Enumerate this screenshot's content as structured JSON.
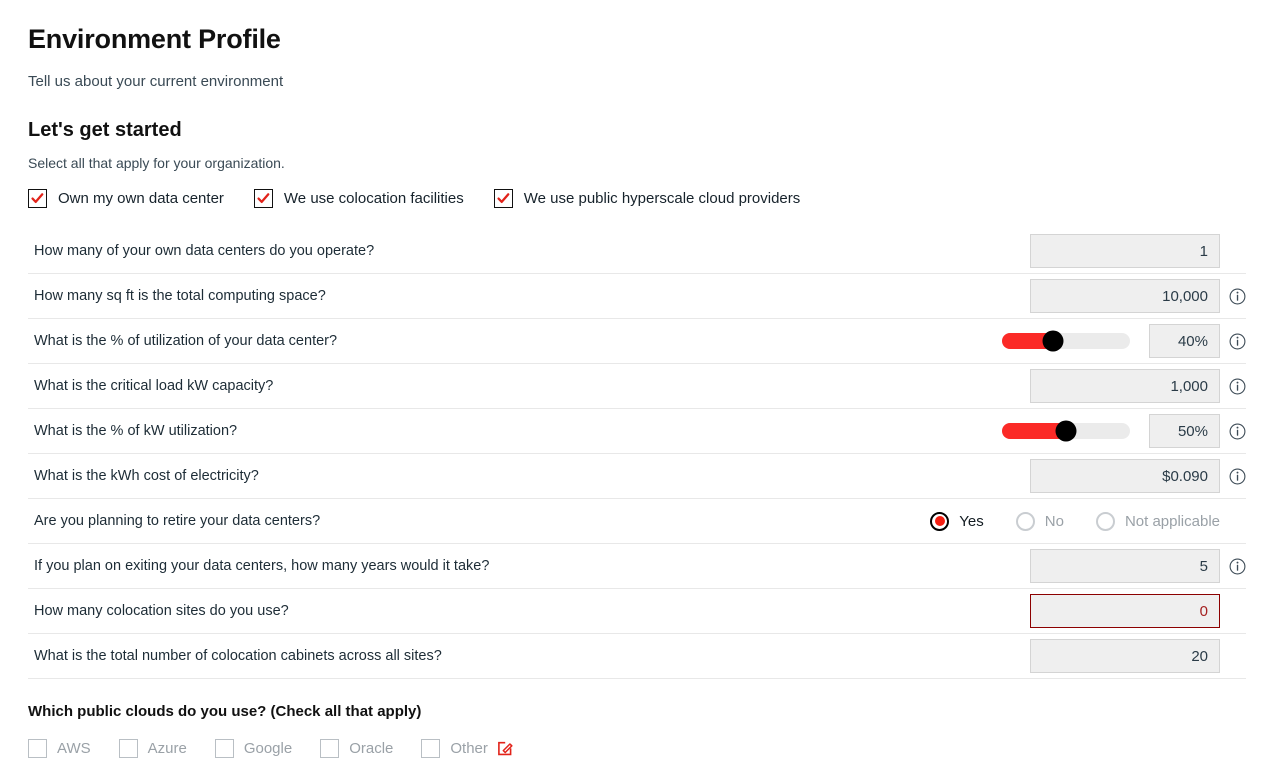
{
  "header": {
    "title": "Environment Profile",
    "subtitle": "Tell us about your current environment",
    "section_title": "Let's get started",
    "section_sub": "Select all that apply for your organization."
  },
  "colors": {
    "accent_red": "#fb2a27",
    "check_red": "#e2231a",
    "error_border": "#8c0000",
    "field_bg": "#efefef"
  },
  "top_checkboxes": [
    {
      "label": "Own my own data center",
      "checked": true,
      "icon": "checkmark-icon"
    },
    {
      "label": "We use colocation facilities",
      "checked": true,
      "icon": "checkmark-icon"
    },
    {
      "label": "We use public hyperscale cloud providers",
      "checked": true,
      "icon": "checkmark-icon"
    }
  ],
  "questions": [
    {
      "label": "How many of your own data centers do you operate?",
      "type": "number",
      "value": "1",
      "info": false
    },
    {
      "label": "How many sq ft is the total computing space?",
      "type": "number",
      "value": "10,000",
      "info": true
    },
    {
      "label": "What is the % of utilization of your data center?",
      "type": "slider",
      "value": "40%",
      "slider_percent": 40,
      "info": true
    },
    {
      "label": "What is the critical load kW capacity?",
      "type": "number",
      "value": "1,000",
      "info": true
    },
    {
      "label": "What is the % of kW utilization?",
      "type": "slider",
      "value": "50%",
      "slider_percent": 50,
      "info": true
    },
    {
      "label": "What is the kWh cost of electricity?",
      "type": "number",
      "value": "$0.090",
      "info": true
    },
    {
      "label": "Are you planning to retire your data centers?",
      "type": "radio",
      "options": [
        {
          "label": "Yes",
          "selected": true
        },
        {
          "label": "No",
          "selected": false
        },
        {
          "label": "Not applicable",
          "selected": false
        }
      ],
      "info": false
    },
    {
      "label": "If you plan on exiting your data centers, how many years would it take?",
      "type": "number",
      "value": "5",
      "info": true
    },
    {
      "label": "How many colocation sites do you use?",
      "type": "number",
      "value": "0",
      "error": true,
      "info": false
    },
    {
      "label": "What is the total number of colocation cabinets across all sites?",
      "type": "number",
      "value": "20",
      "info": false
    }
  ],
  "cloud_section": {
    "title": "Which public clouds do you use? (Check all that apply)",
    "options": [
      {
        "label": "AWS",
        "checked": false
      },
      {
        "label": "Azure",
        "checked": false
      },
      {
        "label": "Google",
        "checked": false
      },
      {
        "label": "Oracle",
        "checked": false
      },
      {
        "label": "Other",
        "checked": false,
        "edit_icon": "edit-pencil-icon"
      }
    ]
  }
}
